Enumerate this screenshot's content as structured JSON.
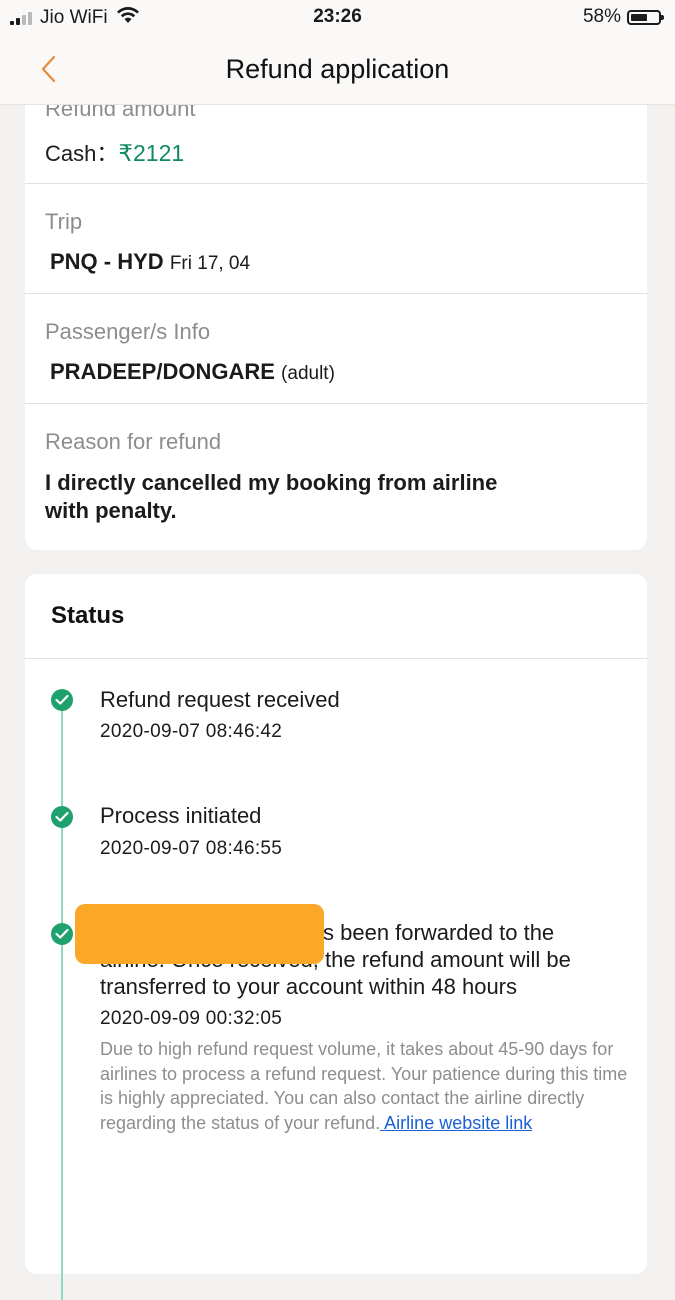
{
  "status_bar": {
    "carrier": "Jio WiFi",
    "time": "23:26",
    "battery": "58%"
  },
  "header": {
    "title": "Refund application"
  },
  "details": {
    "refund_amount_label": "Refund amount",
    "cash_label": "Cash：",
    "cash_value": "₹2121",
    "trip_label": "Trip",
    "trip_route": "PNQ - HYD",
    "trip_date": "Fri 17, 04",
    "passenger_label": "Passenger/s Info",
    "passenger_name": "PRADEEP/DONGARE",
    "passenger_type": "(adult)",
    "reason_label": "Reason for refund",
    "reason_value": "I directly cancelled my booking from airline with penalty."
  },
  "status": {
    "title": "Status",
    "steps": [
      {
        "title": "Refund request received",
        "time": "2020-09-07 08:46:42"
      },
      {
        "title": "Process initiated",
        "time": "2020-09-07 08:46:55"
      },
      {
        "title": "Your refund request has been forwarded to the airline. Once received, the refund amount will be transferred to your account within 48 hours",
        "time": "2020-09-09 00:32:05",
        "note": "Due to high refund request volume, it takes about 45-90 days for airlines to process a refund request. Your patience during this time is highly appreciated. You can also contact the airline directly regarding the status of your refund.",
        "link": " Airline website link"
      }
    ]
  },
  "colors": {
    "accent_orange": "#fba727",
    "success_green": "#1fa16e",
    "amount_green": "#118a63",
    "link_blue": "#1a5fd6"
  },
  "icons": {
    "back": "chevron-left-icon",
    "check": "check-icon",
    "wifi": "wifi-icon",
    "battery": "battery-icon",
    "signal": "signal-icon"
  }
}
